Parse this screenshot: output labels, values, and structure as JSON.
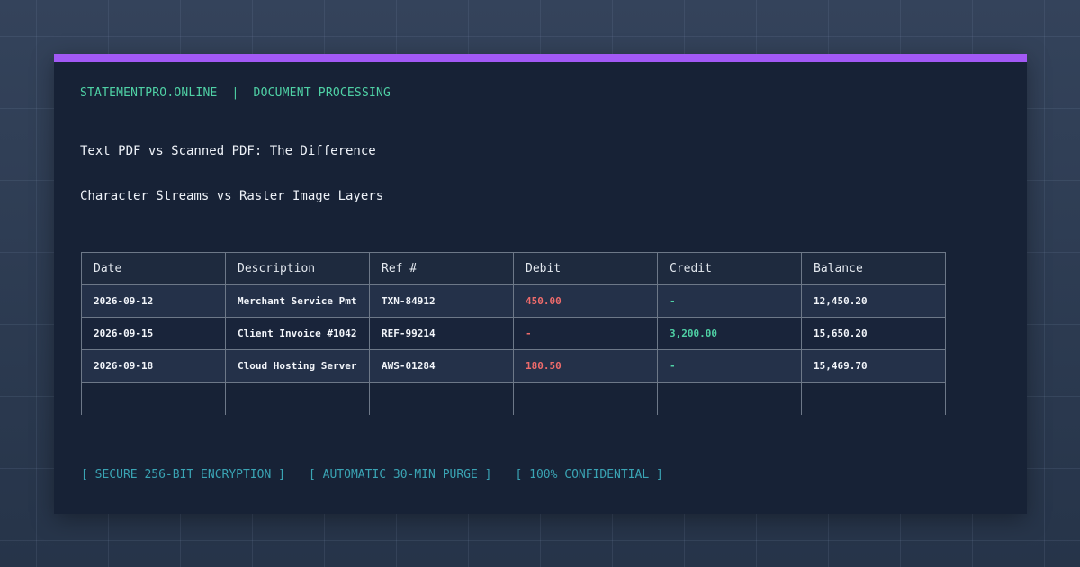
{
  "header": {
    "brand": "STATEMENTPRO.ONLINE",
    "separator": "|",
    "section": "DOCUMENT PROCESSING"
  },
  "title": "Text PDF vs Scanned PDF: The Difference",
  "subtitle": "Character Streams vs Raster Image Layers",
  "table": {
    "headers": [
      "Date",
      "Description",
      "Ref #",
      "Debit",
      "Credit",
      "Balance"
    ],
    "rows": [
      [
        "2026-09-12",
        "Merchant Service Pmt",
        "TXN-84912",
        "450.00",
        "-",
        "12,450.20"
      ],
      [
        "2026-09-15",
        "Client Invoice #1042",
        "REF-99214",
        "-",
        "3,200.00",
        "15,650.20"
      ],
      [
        "2026-09-18",
        "Cloud Hosting Server",
        "AWS-01284",
        "180.50",
        "-",
        "15,469.70"
      ]
    ]
  },
  "footer": {
    "badges": [
      "[ SECURE 256-BIT ENCRYPTION ]",
      "[ AUTOMATIC 30-MIN PURGE ]",
      "[ 100% CONFIDENTIAL ]"
    ]
  },
  "colors": {
    "accent": "#a259f5",
    "brand_green": "#4fd1a5",
    "debit_red": "#ee6b6b",
    "footer_teal": "#3aa4b4",
    "card_bg": "#172236"
  }
}
